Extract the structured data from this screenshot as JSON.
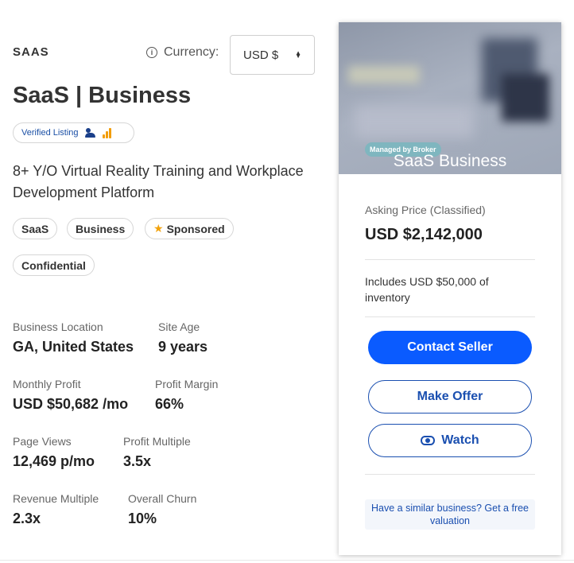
{
  "listing": {
    "category": "SAAS",
    "title": "SaaS | Business",
    "verified_label": "Verified Listing",
    "subtitle": "8+ Y/O Virtual Reality Training and Workplace Development Platform",
    "tags": [
      "SaaS",
      "Business",
      "Sponsored",
      "Confidential"
    ]
  },
  "currency": {
    "label": "Currency:",
    "selected": "USD $"
  },
  "metrics": [
    {
      "label": "Business Location",
      "value": "GA, United States"
    },
    {
      "label": "Site Age",
      "value": "9 years"
    },
    {
      "label": "Monthly Profit",
      "value": "USD $50,682 /mo"
    },
    {
      "label": "Profit Margin",
      "value": "66%"
    },
    {
      "label": "Page Views",
      "value": "12,469 p/mo"
    },
    {
      "label": "Profit Multiple",
      "value": "3.5x"
    },
    {
      "label": "Revenue Multiple",
      "value": "2.3x"
    },
    {
      "label": "Overall Churn",
      "value": "10%"
    }
  ],
  "card": {
    "badge": "Managed by Broker",
    "hero_title": "SaaS Business",
    "asking_label": "Asking Price (Classified)",
    "asking_price": "USD $2,142,000",
    "inventory_note": "Includes USD $50,000 of inventory",
    "contact_label": "Contact Seller",
    "offer_label": "Make Offer",
    "watch_label": "Watch",
    "valuation_text": "Have a similar business? Get a free valuation"
  },
  "colors": {
    "primary": "#0a5bff",
    "link": "#1a4fb0",
    "star": "#f2a20c"
  },
  "icons": [
    "info-icon",
    "chevron-updown-icon",
    "people-icon",
    "analytics-icon",
    "star-icon",
    "eye-icon"
  ]
}
